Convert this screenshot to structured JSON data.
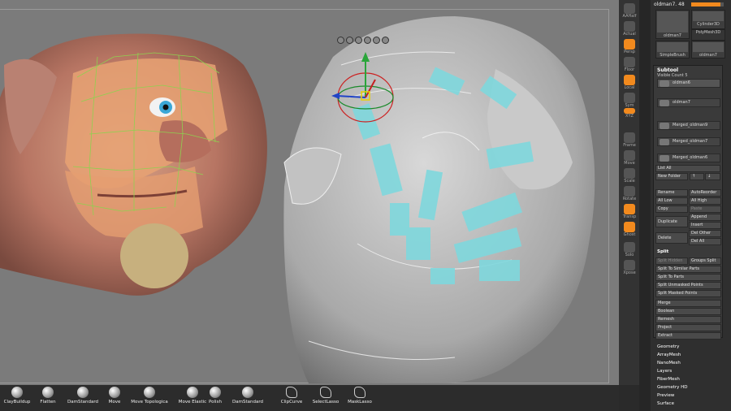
{
  "tool": {
    "name": "oldman7. 48"
  },
  "tool_thumbs": [
    {
      "label": "oldman7",
      "badge": "5"
    },
    {
      "label": "Cylinder3D"
    },
    {
      "label": "PolyMesh3D"
    },
    {
      "label": "SimpleBrush"
    },
    {
      "label": "oldman7",
      "badge": "5"
    }
  ],
  "side_toolbar": [
    {
      "label": "AAHalf"
    },
    {
      "label": "Actual"
    },
    {
      "label": "Persp"
    },
    {
      "label": "Floor"
    },
    {
      "label": "Local"
    },
    {
      "label": "Sym"
    },
    {
      "label": "XYZ"
    },
    {
      "label": "Frame"
    },
    {
      "label": "Move"
    },
    {
      "label": "Scale"
    },
    {
      "label": "Rotate"
    },
    {
      "label": "Transp"
    },
    {
      "label": "Ghost"
    },
    {
      "label": "Solo"
    },
    {
      "label": "Xpose"
    }
  ],
  "subtool": {
    "title": "Subtool",
    "visible_count": "Visible Count 5",
    "items": [
      "oldman6",
      "oldman7",
      "Merged_oldman9",
      "Merged_oldman7",
      "Merged_oldman6"
    ],
    "list_all": "List All",
    "new_folder": "New Folder",
    "buttons": {
      "rename": "Rename",
      "autoreorder": "AutoReorder",
      "all_low": "All Low",
      "all_high": "All High",
      "copy": "Copy",
      "paste": "Paste",
      "append": "Append",
      "duplicate": "Duplicate",
      "insert": "Insert",
      "delete": "Delete",
      "del_other": "Del Other",
      "del_all": "Del All"
    },
    "split": {
      "title": "Split",
      "split_hidden": "Split Hidden",
      "groups_split": "Groups Split",
      "to_similar": "Split To Similar Parts",
      "to_parts": "Split To Parts",
      "unmasked": "Split Unmasked Points",
      "masked": "Split Masked Points"
    },
    "actions": [
      "Merge",
      "Boolean",
      "Remesh",
      "Project",
      "Extract"
    ]
  },
  "menus": [
    "Geometry",
    "ArrayMesh",
    "NanoMesh",
    "Layers",
    "FiberMesh",
    "Geometry HD",
    "Preview",
    "Surface"
  ],
  "brushes": [
    "ClayBuildup",
    "Flatten",
    "DamStandard",
    "Move",
    "Move Topologica",
    "Move Elastic",
    "Polish",
    "DamStandard",
    "ClipCurve",
    "SelectLasso",
    "MaskLasso"
  ]
}
